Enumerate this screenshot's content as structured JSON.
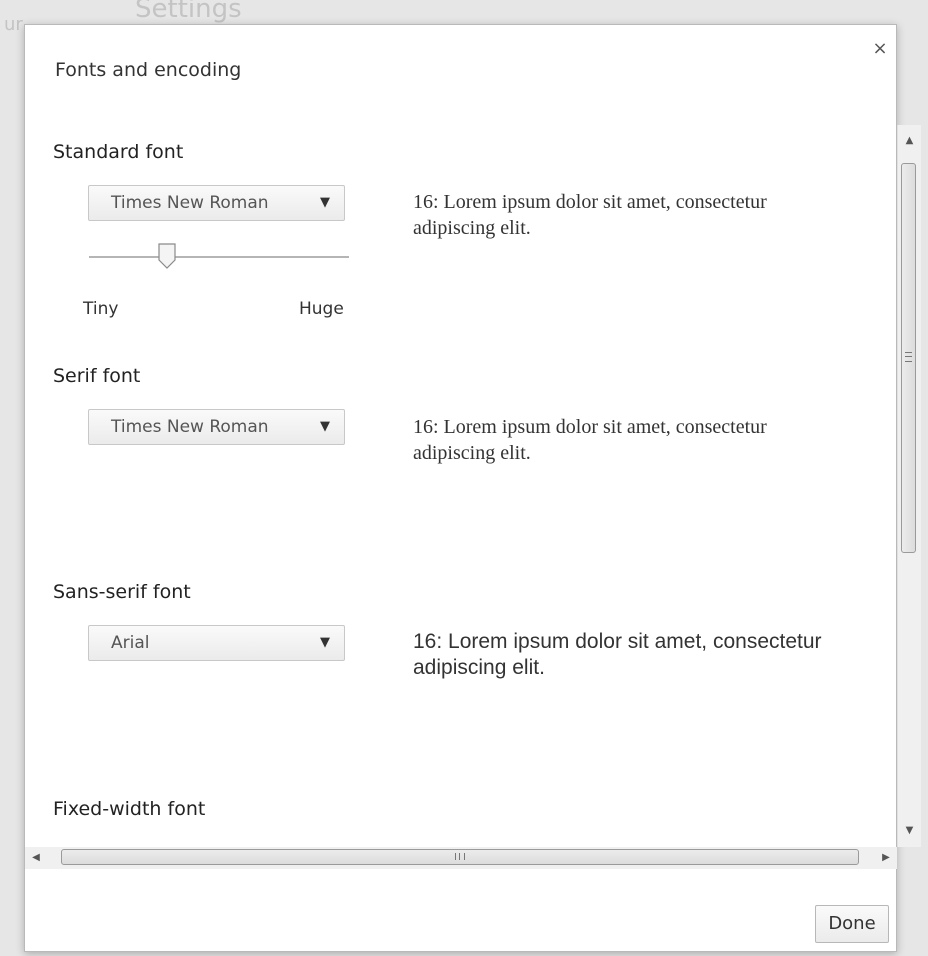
{
  "backdrop": {
    "title": "Settings",
    "left_fragment": "ur"
  },
  "dialog": {
    "title": "Fonts and encoding",
    "close_label": "×"
  },
  "sections": [
    {
      "title": "Standard font",
      "select_value": "Times New Roman",
      "sample": "16: Lorem ipsum dolor sit amet, consectetur adipiscing elit."
    },
    {
      "title": "Serif font",
      "select_value": "Times New Roman",
      "sample": "16: Lorem ipsum dolor sit amet, consectetur adipiscing elit."
    },
    {
      "title": "Sans-serif font",
      "select_value": "Arial",
      "sample": "16: Lorem ipsum dolor sit amet, consectetur adipiscing elit."
    },
    {
      "title": "Fixed-width font"
    }
  ],
  "slider": {
    "min_label": "Tiny",
    "max_label": "Huge",
    "position_fraction": 0.3
  },
  "icons": {
    "dropdown": "chevron-down-icon",
    "scroll_up": "arrow-up-icon",
    "scroll_down": "arrow-down-icon",
    "scroll_left": "arrow-left-icon",
    "scroll_right": "arrow-right-icon",
    "close": "close-icon"
  },
  "footer": {
    "done_label": "Done"
  }
}
